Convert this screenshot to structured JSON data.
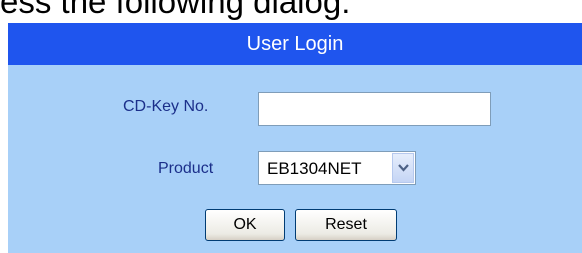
{
  "caption": "ess the following dialog:",
  "dialog": {
    "title": "User Login",
    "cdkey_label": "CD-Key No.",
    "cdkey_value": "",
    "product_label": "Product",
    "product_selected": "EB1304NET",
    "ok_label": "OK",
    "reset_label": "Reset"
  },
  "colors": {
    "titlebar": "#1f55ee",
    "panel": "#a8d0f8",
    "label_text": "#1b2f8a"
  },
  "icons": {
    "dropdown": "chevron-down-icon"
  }
}
